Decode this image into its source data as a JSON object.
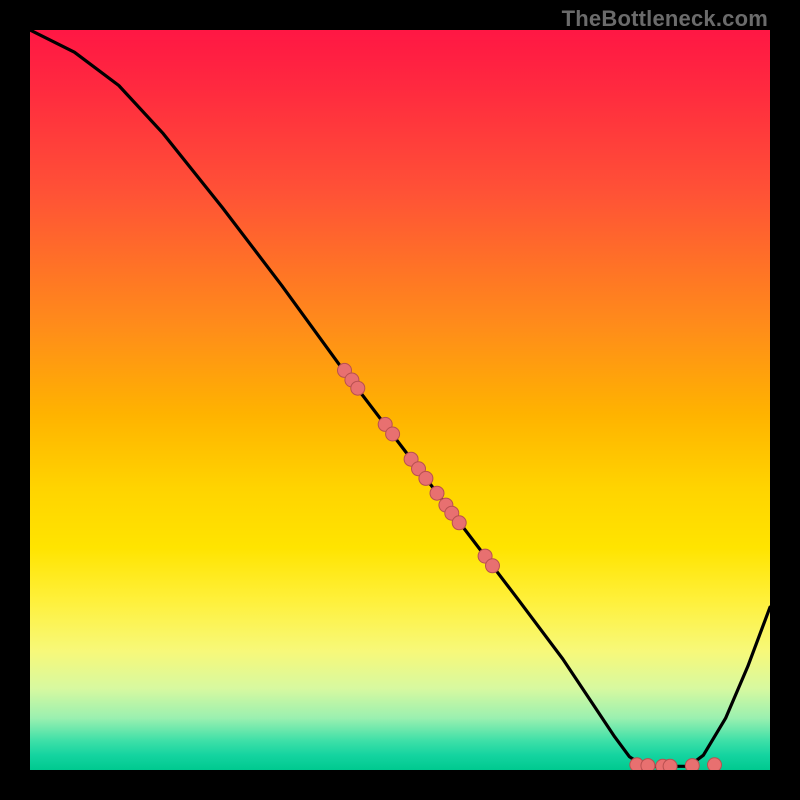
{
  "watermark": "TheBottleneck.com",
  "colors": {
    "curve": "#000000",
    "marker_fill": "#e87070",
    "marker_stroke": "#b85050"
  },
  "chart_data": {
    "type": "line",
    "title": "",
    "xlabel": "",
    "ylabel": "",
    "xlim": [
      0,
      100
    ],
    "ylim": [
      0,
      100
    ],
    "grid": false,
    "curve": {
      "comment": "x,y in percent of plot area, y=0 is TOP (as drawn). Values read from the figure.",
      "points": [
        [
          0,
          0
        ],
        [
          6,
          3
        ],
        [
          12,
          7.5
        ],
        [
          18,
          14
        ],
        [
          26,
          24
        ],
        [
          34,
          34.5
        ],
        [
          42,
          45.5
        ],
        [
          50,
          56
        ],
        [
          58,
          66.5
        ],
        [
          66,
          77
        ],
        [
          72,
          85
        ],
        [
          76,
          91
        ],
        [
          79,
          95.5
        ],
        [
          81,
          98.2
        ],
        [
          83,
          99.5
        ],
        [
          86,
          99.5
        ],
        [
          89,
          99.5
        ],
        [
          91,
          98
        ],
        [
          94,
          93
        ],
        [
          97,
          86
        ],
        [
          100,
          78
        ]
      ]
    },
    "markers": {
      "comment": "Scatter markers along the curve and along the valley floor; x,y in percent of plot area (y=0 top).",
      "points": [
        [
          42.5,
          46
        ],
        [
          43.5,
          47.3
        ],
        [
          44.3,
          48.4
        ],
        [
          48.0,
          53.3
        ],
        [
          49.0,
          54.6
        ],
        [
          51.5,
          58.0
        ],
        [
          52.5,
          59.3
        ],
        [
          53.5,
          60.6
        ],
        [
          55.0,
          62.6
        ],
        [
          56.2,
          64.2
        ],
        [
          57.0,
          65.3
        ],
        [
          58.0,
          66.6
        ],
        [
          61.5,
          71.1
        ],
        [
          62.5,
          72.4
        ],
        [
          82.0,
          99.3
        ],
        [
          83.5,
          99.4
        ],
        [
          85.5,
          99.5
        ],
        [
          86.5,
          99.5
        ],
        [
          89.5,
          99.4
        ],
        [
          92.5,
          99.3
        ]
      ],
      "radius_px": 7
    }
  }
}
